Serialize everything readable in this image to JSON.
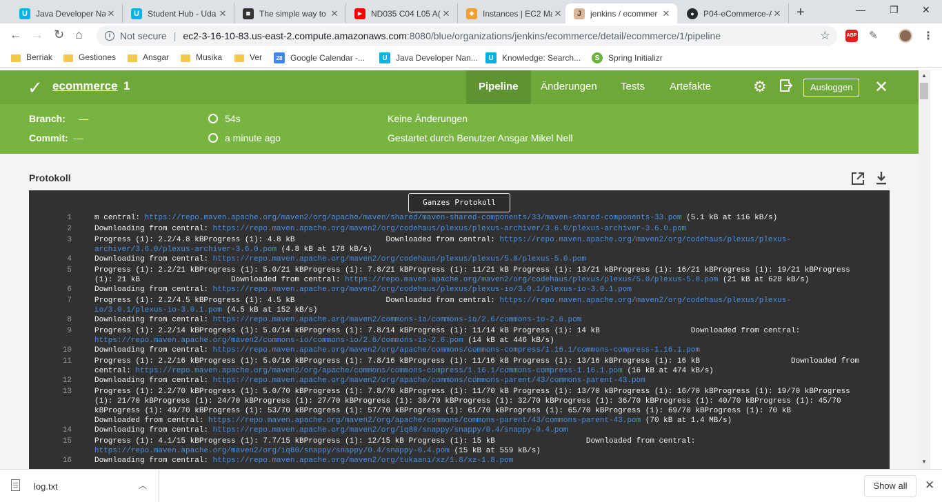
{
  "tabs": [
    {
      "title": "Java Developer Na",
      "fav": "U",
      "fav_color": "#02b3e4"
    },
    {
      "title": "Student Hub - Uda",
      "fav": "U",
      "fav_color": "#02b3e4"
    },
    {
      "title": "The simple way to",
      "fav": "■",
      "fav_color": "#333333"
    },
    {
      "title": "ND035 C04 L05 A(",
      "fav": "▶",
      "fav_color": "#ff0000"
    },
    {
      "title": "Instances | EC2 Ma",
      "fav": "◆",
      "fav_color": "#f0a030"
    },
    {
      "title": "jenkins / ecommer",
      "fav": "J",
      "fav_color": "#d33833"
    },
    {
      "title": "P04-eCommerce-A",
      "fav": "●",
      "fav_color": "#24292e"
    }
  ],
  "address": {
    "security": "Not secure",
    "host": "ec2-3-16-10-83.us-east-2.compute.amazonaws.com",
    "path": ":8080/blue/organizations/jenkins/ecommerce/detail/ecommerce/1/pipeline"
  },
  "extensions": {
    "abp": "ABP"
  },
  "bookmarks": [
    {
      "label": "Berriak",
      "type": "folder"
    },
    {
      "label": "Gestiones",
      "type": "folder"
    },
    {
      "label": "Ansgar",
      "type": "folder"
    },
    {
      "label": "Musika",
      "type": "folder"
    },
    {
      "label": "Ver",
      "type": "folder"
    },
    {
      "label": "Google Calendar -...",
      "type": "calendar",
      "icon_text": "28"
    },
    {
      "label": "Java Developer Nan...",
      "type": "udacity",
      "icon_text": "U"
    },
    {
      "label": "Knowledge: Search...",
      "type": "udacity",
      "icon_text": "U"
    },
    {
      "label": "Spring Initializr",
      "type": "spring",
      "icon_text": "S"
    }
  ],
  "jenkins": {
    "pipeline_name": "ecommerce",
    "run_number": "1",
    "nav_tabs": [
      "Pipeline",
      "Änderungen",
      "Tests",
      "Artefakte"
    ],
    "logout_label": "Ausloggen",
    "branch_label": "Branch:",
    "branch_value": "—",
    "commit_label": "Commit:",
    "commit_value": "—",
    "duration": "54s",
    "started_ago": "a minute ago",
    "changes": "Keine Änderungen",
    "started_by": "Gestartet durch Benutzer Ansgar Mikel Nell",
    "log_title": "Protokoll",
    "full_log_button": "Ganzes Protokoll"
  },
  "log_lines": [
    {
      "n": "1",
      "parts": [
        [
          "m central: ",
          0
        ],
        [
          "https://repo.maven.apache.org/maven2/org/apache/maven/shared/maven-shared-components/33/maven-shared-components-33.pom",
          1
        ],
        [
          " (5.1 kB at 116 kB/s)",
          0
        ]
      ]
    },
    {
      "n": "2",
      "parts": [
        [
          "Downloading from central: ",
          0
        ],
        [
          "https://repo.maven.apache.org/maven2/org/codehaus/plexus/plexus-archiver/3.6.0/plexus-archiver-3.6.0.pom",
          1
        ]
      ]
    },
    {
      "n": "3",
      "parts": [
        [
          "Progress (1): 2.2/4.8 kBProgress (1): 4.8 kB                    Downloaded from central: ",
          0
        ],
        [
          "https://repo.maven.apache.org/maven2/org/codehaus/plexus/plexus-archiver/3.6.0/plexus-archiver-3.6.0.pom",
          1
        ],
        [
          " (4.8 kB at 178 kB/s)",
          0
        ]
      ]
    },
    {
      "n": "4",
      "parts": [
        [
          "Downloading from central: ",
          0
        ],
        [
          "https://repo.maven.apache.org/maven2/org/codehaus/plexus/plexus/5.0/plexus-5.0.pom",
          1
        ]
      ]
    },
    {
      "n": "5",
      "parts": [
        [
          "Progress (1): 2.2/21 kBProgress (1): 5.0/21 kBProgress (1): 7.8/21 kBProgress (1): 11/21 kB Progress (1): 13/21 kBProgress (1): 16/21 kBProgress (1): 19/21 kBProgress (1): 21 kB                    Downloaded from central: ",
          0
        ],
        [
          "https://repo.maven.apache.org/maven2/org/codehaus/plexus/plexus/5.0/plexus-5.0.pom",
          1
        ],
        [
          " (21 kB at 628 kB/s)",
          0
        ]
      ]
    },
    {
      "n": "6",
      "parts": [
        [
          "Downloading from central: ",
          0
        ],
        [
          "https://repo.maven.apache.org/maven2/org/codehaus/plexus/plexus-io/3.0.1/plexus-io-3.0.1.pom",
          1
        ]
      ]
    },
    {
      "n": "7",
      "parts": [
        [
          "Progress (1): 2.2/4.5 kBProgress (1): 4.5 kB                    Downloaded from central: ",
          0
        ],
        [
          "https://repo.maven.apache.org/maven2/org/codehaus/plexus/plexus-io/3.0.1/plexus-io-3.0.1.pom",
          1
        ],
        [
          " (4.5 kB at 152 kB/s)",
          0
        ]
      ]
    },
    {
      "n": "8",
      "parts": [
        [
          "Downloading from central: ",
          0
        ],
        [
          "https://repo.maven.apache.org/maven2/commons-io/commons-io/2.6/commons-io-2.6.pom",
          1
        ]
      ]
    },
    {
      "n": "9",
      "parts": [
        [
          "Progress (1): 2.2/14 kBProgress (1): 5.0/14 kBProgress (1): 7.8/14 kBProgress (1): 11/14 kB Progress (1): 14 kB                    Downloaded from central: ",
          0
        ],
        [
          "https://repo.maven.apache.org/maven2/commons-io/commons-io/2.6/commons-io-2.6.pom",
          1
        ],
        [
          " (14 kB at 446 kB/s)",
          0
        ]
      ]
    },
    {
      "n": "10",
      "parts": [
        [
          "Downloading from central: ",
          0
        ],
        [
          "https://repo.maven.apache.org/maven2/org/apache/commons/commons-compress/1.16.1/commons-compress-1.16.1.pom",
          1
        ]
      ]
    },
    {
      "n": "11",
      "parts": [
        [
          "Progress (1): 2.2/16 kBProgress (1): 5.0/16 kBProgress (1): 7.8/16 kBProgress (1): 11/16 kB Progress (1): 13/16 kBProgress (1): 16 kB                    Downloaded from central: ",
          0
        ],
        [
          "https://repo.maven.apache.org/maven2/org/apache/commons/commons-compress/1.16.1/commons-compress-1.16.1.pom",
          1
        ],
        [
          " (16 kB at 474 kB/s)",
          0
        ]
      ]
    },
    {
      "n": "12",
      "parts": [
        [
          "Downloading from central: ",
          0
        ],
        [
          "https://repo.maven.apache.org/maven2/org/apache/commons/commons-parent/43/commons-parent-43.pom",
          1
        ]
      ]
    },
    {
      "n": "13",
      "parts": [
        [
          "Progress (1): 2.2/70 kBProgress (1): 5.0/70 kBProgress (1): 7.8/70 kBProgress (1): 11/70 kB Progress (1): 13/70 kBProgress (1): 16/70 kBProgress (1): 19/70 kBProgress (1): 21/70 kBProgress (1): 24/70 kBProgress (1): 27/70 kBProgress (1): 30/70 kBProgress (1): 32/70 kBProgress (1): 36/70 kBProgress (1): 40/70 kBProgress (1): 45/70 kBProgress (1): 49/70 kBProgress (1): 53/70 kBProgress (1): 57/70 kBProgress (1): 61/70 kBProgress (1): 65/70 kBProgress (1): 69/70 kBProgress (1): 70 kB\nDownloaded from central: ",
          0
        ],
        [
          "https://repo.maven.apache.org/maven2/org/apache/commons/commons-parent/43/commons-parent-43.pom",
          1
        ],
        [
          " (70 kB at 1.4 MB/s)",
          0
        ]
      ]
    },
    {
      "n": "14",
      "parts": [
        [
          "Downloading from central: ",
          0
        ],
        [
          "https://repo.maven.apache.org/maven2/org/iq80/snappy/snappy/0.4/snappy-0.4.pom",
          1
        ]
      ]
    },
    {
      "n": "15",
      "parts": [
        [
          "Progress (1): 4.1/15 kBProgress (1): 7.7/15 kBProgress (1): 12/15 kB Progress (1): 15 kB                    Downloaded from central: ",
          0
        ],
        [
          "https://repo.maven.apache.org/maven2/org/iq80/snappy/snappy/0.4/snappy-0.4.pom",
          1
        ],
        [
          " (15 kB at 559 kB/s)",
          0
        ]
      ]
    },
    {
      "n": "16",
      "parts": [
        [
          "Downloading from central: ",
          0
        ],
        [
          "https://repo.maven.apache.org/maven2/org/tukaani/xz/1.8/xz-1.8.pom",
          1
        ]
      ]
    }
  ],
  "download": {
    "filename": "log.txt",
    "show_all": "Show all"
  }
}
